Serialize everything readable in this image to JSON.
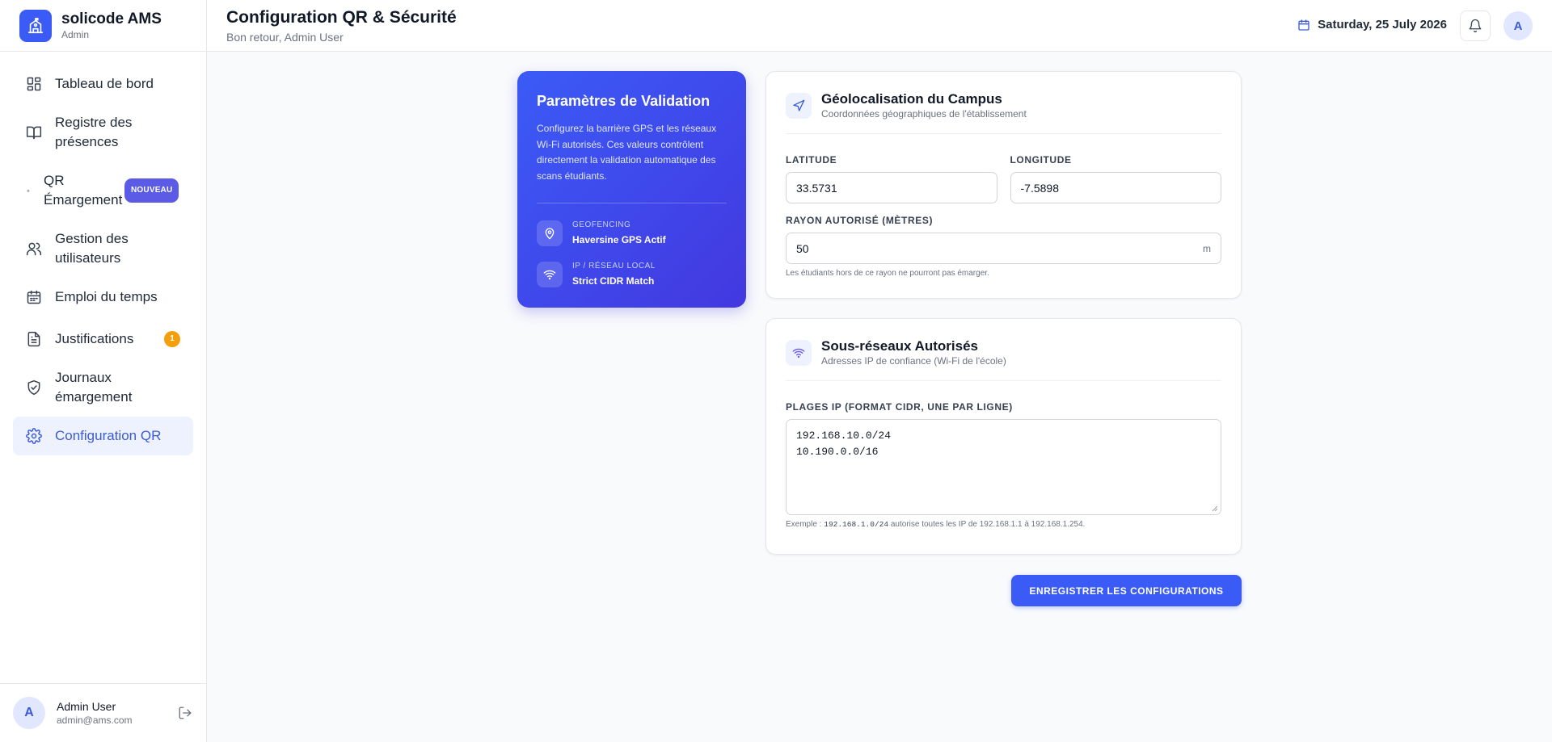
{
  "brand": {
    "name": "solicode AMS",
    "role": "Admin"
  },
  "sidebar": {
    "items": [
      {
        "label": "Tableau de bord",
        "icon": "dashboard-icon"
      },
      {
        "label": "Registre des présences",
        "icon": "book-icon"
      },
      {
        "label": "QR Émargement",
        "icon": "qr-icon",
        "badge": "NOUVEAU"
      },
      {
        "label": "Gestion des utilisateurs",
        "icon": "users-icon"
      },
      {
        "label": "Emploi du temps",
        "icon": "calendar-icon"
      },
      {
        "label": "Justifications",
        "icon": "document-icon",
        "badge": "1"
      },
      {
        "label": "Journaux émargement",
        "icon": "shield-icon"
      },
      {
        "label": "Configuration QR",
        "icon": "gear-icon",
        "active": true
      }
    ]
  },
  "user": {
    "initial": "A",
    "name": "Admin User",
    "email": "admin@ams.com"
  },
  "header": {
    "title": "Configuration QR & Sécurité",
    "subtitle": "Bon retour, Admin User",
    "date": "Saturday, 25 July 2026",
    "avatar_initial": "A"
  },
  "info_card": {
    "title": "Paramètres de Validation",
    "description": "Configurez la barrière GPS et les réseaux Wi-Fi autorisés. Ces valeurs contrôlent directement la validation automatique des scans étudiants.",
    "rows": [
      {
        "key": "GEOFENCING",
        "value": "Haversine GPS Actif",
        "icon": "map-pin-icon"
      },
      {
        "key": "IP / RÉSEAU LOCAL",
        "value": "Strict CIDR Match",
        "icon": "wifi-icon"
      }
    ]
  },
  "geo_card": {
    "title": "Géolocalisation du Campus",
    "subtitle": "Coordonnées géographiques de l'établissement",
    "latitude_label": "LATITUDE",
    "latitude_value": "33.5731",
    "longitude_label": "LONGITUDE",
    "longitude_value": "-7.5898",
    "radius_label": "RAYON AUTORISÉ (MÈTRES)",
    "radius_value": "50",
    "radius_unit": "m",
    "radius_hint": "Les étudiants hors de ce rayon ne pourront pas émarger."
  },
  "subnet_card": {
    "title": "Sous-réseaux Autorisés",
    "subtitle": "Adresses IP de confiance (Wi-Fi de l'école)",
    "ranges_label": "PLAGES IP (FORMAT CIDR, UNE PAR LIGNE)",
    "ranges_value": "192.168.10.0/24\n10.190.0.0/16",
    "hint_prefix": "Exemple : ",
    "hint_code": "192.168.1.0/24",
    "hint_suffix": " autorise toutes les IP de 192.168.1.1 à 192.168.1.254."
  },
  "actions": {
    "save_label": "ENREGISTRER LES CONFIGURATIONS"
  },
  "colors": {
    "accent": "#3b5bf6",
    "accent_dark": "#4338e0",
    "warning": "#f59e0b",
    "badge_new": "#5b5be6"
  }
}
